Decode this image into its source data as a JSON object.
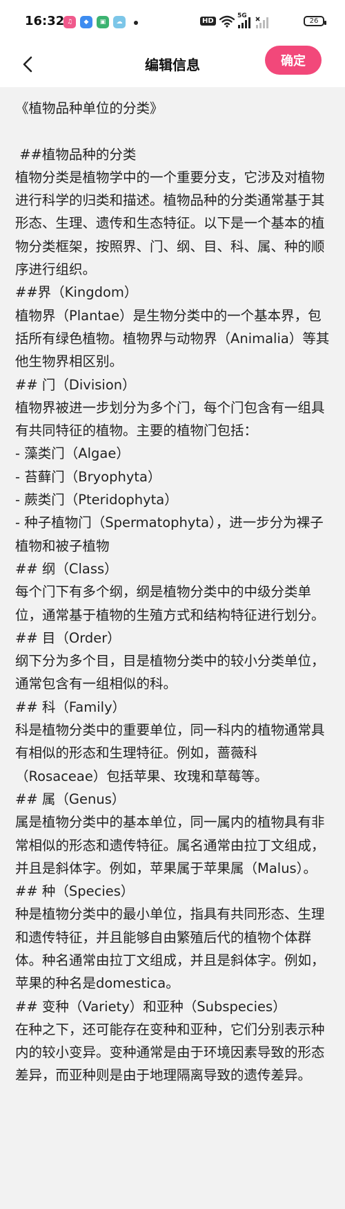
{
  "status_bar": {
    "time": "16:32",
    "app_icons": [
      "music-app-icon",
      "bird-app-icon",
      "shop-app-icon",
      "chat-app-icon"
    ],
    "hd_label": "HD",
    "network_label": "5G",
    "battery_level": "26"
  },
  "header": {
    "back_icon": "chevron-left-icon",
    "title": "编辑信息",
    "confirm_label": "确定",
    "confirm_color": "#f2487a"
  },
  "editor": {
    "content": "《植物品种单位的分类》\n\n ##植物品种的分类\n植物分类是植物学中的一个重要分支，它涉及对植物进行科学的归类和描述。植物品种的分类通常基于其形态、生理、遗传和生态特征。以下是一个基本的植物分类框架，按照界、门、纲、目、科、属、种的顺序进行组织。\n##界（Kingdom）\n植物界（Plantae）是生物分类中的一个基本界，包括所有绿色植物。植物界与动物界（Animalia）等其他生物界相区别。\n## 门（Division）\n植物界被进一步划分为多个门，每个门包含有一组具有共同特征的植物。主要的植物门包括：\n- 藻类门（Algae）\n- 苔藓门（Bryophyta）\n- 蕨类门（Pteridophyta）\n- 种子植物门（Spermatophyta），进一步分为裸子植物和被子植物\n## 纲（Class）\n每个门下有多个纲，纲是植物分类中的中级分类单位，通常基于植物的生殖方式和结构特征进行划分。\n## 目（Order）\n纲下分为多个目，目是植物分类中的较小分类单位，通常包含有一组相似的科。\n## 科（Family）\n科是植物分类中的重要单位，同一科内的植物通常具有相似的形态和生理特征。例如，蔷薇科（Rosaceae）包括苹果、玫瑰和草莓等。\n## 属（Genus）\n属是植物分类中的基本单位，同一属内的植物具有非常相似的形态和遗传特征。属名通常由拉丁文组成，并且是斜体字。例如，苹果属于苹果属（Malus）。\n## 种（Species）\n种是植物分类中的最小单位，指具有共同形态、生理和遗传特征，并且能够自由繁殖后代的植物个体群体。种名通常由拉丁文组成，并且是斜体字。例如，苹果的种名是domestica。\n## 变种（Variety）和亚种（Subspecies）\n在种之下，还可能存在变种和亚种，它们分别表示种内的较小变异。变种通常是由于环境因素导致的形态差异，而亚种则是由于地理隔离导致的遗传差异。"
  }
}
